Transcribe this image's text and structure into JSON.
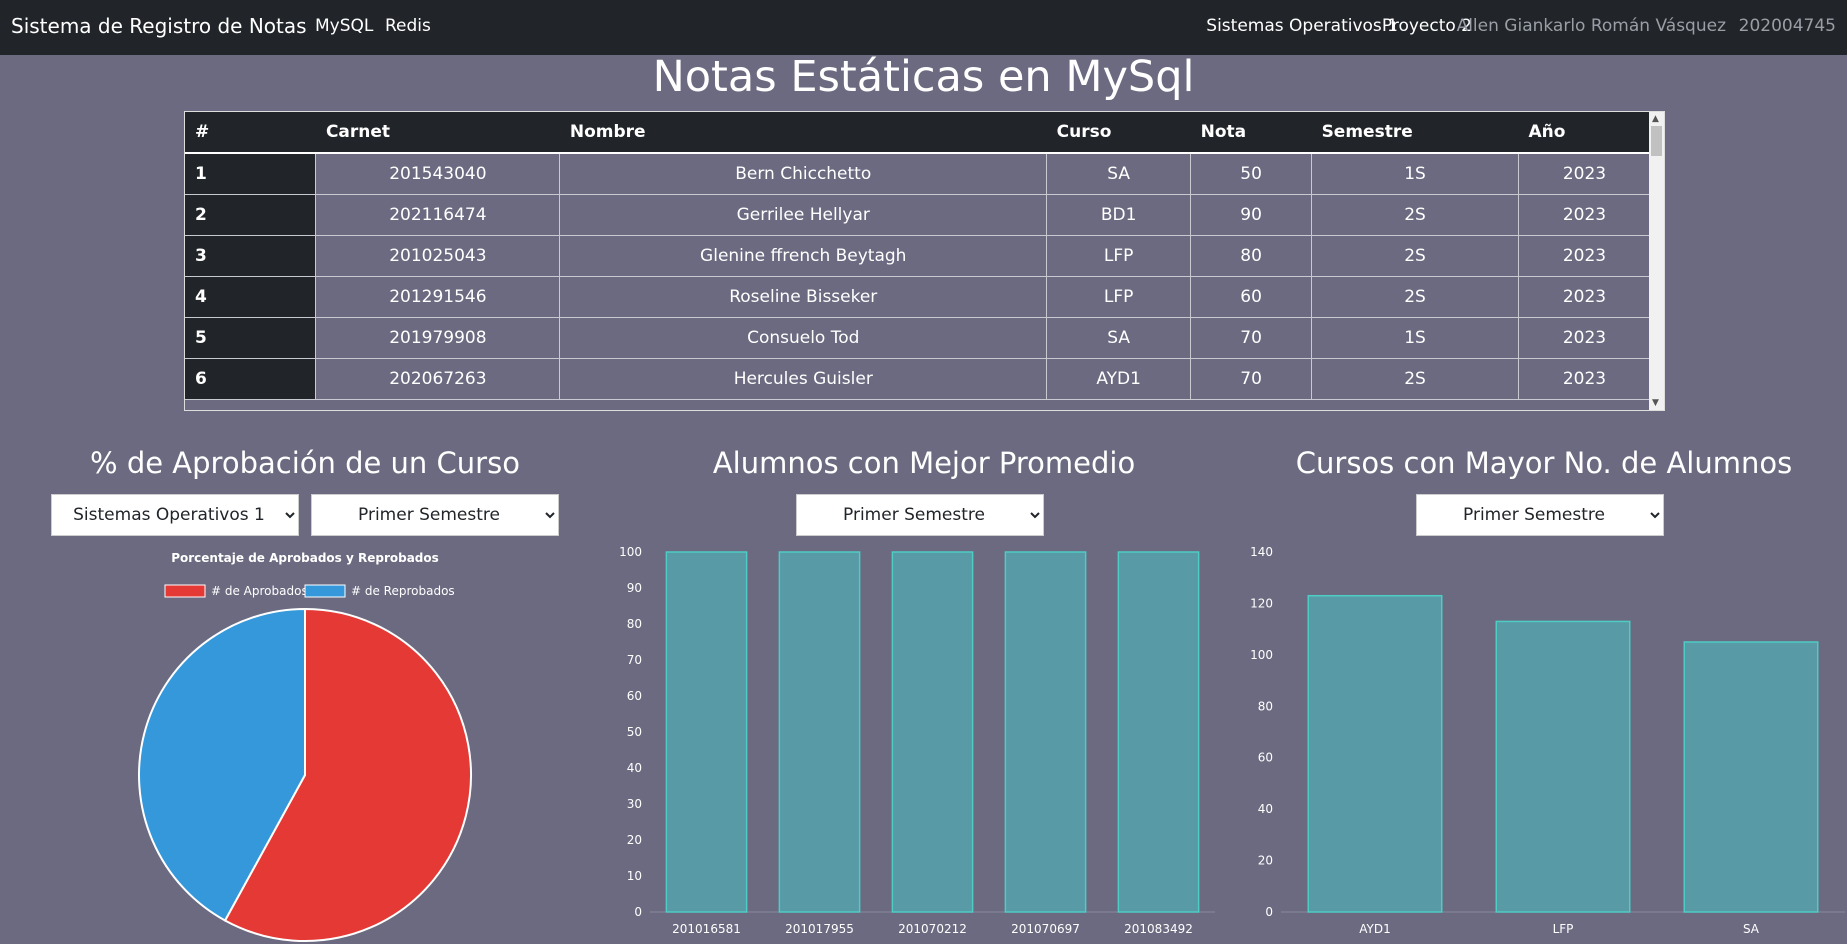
{
  "navbar": {
    "brand": "Sistema de Registro de Notas",
    "links": [
      "MySQL",
      "Redis"
    ],
    "right": [
      "Sistemas Operativos 1",
      "Proyecto 2",
      "Allen Giankarlo Román Vásquez",
      "202004745"
    ]
  },
  "page_title": "Notas Estáticas en MySql",
  "table": {
    "headers": [
      "#",
      "Carnet",
      "Nombre",
      "Curso",
      "Nota",
      "Semestre",
      "Año"
    ],
    "rows": [
      [
        "1",
        "201543040",
        "Bern Chicchetto",
        "SA",
        "50",
        "1S",
        "2023"
      ],
      [
        "2",
        "202116474",
        "Gerrilee Hellyar",
        "BD1",
        "90",
        "2S",
        "2023"
      ],
      [
        "3",
        "201025043",
        "Glenine ffrench Beytagh",
        "LFP",
        "80",
        "2S",
        "2023"
      ],
      [
        "4",
        "201291546",
        "Roseline Bisseker",
        "LFP",
        "60",
        "2S",
        "2023"
      ],
      [
        "5",
        "201979908",
        "Consuelo Tod",
        "SA",
        "70",
        "1S",
        "2023"
      ],
      [
        "6",
        "202067263",
        "Hercules Guisler",
        "AYD1",
        "70",
        "2S",
        "2023"
      ]
    ]
  },
  "sections": {
    "aprobacion": {
      "title": "% de Aprobación de un Curso",
      "course_select": "Sistemas Operativos 1",
      "semester_select": "Primer Semestre"
    },
    "promedio": {
      "title": "Alumnos con Mejor Promedio",
      "semester_select": "Primer Semestre"
    },
    "cursos": {
      "title": "Cursos con Mayor No. de Alumnos",
      "semester_select": "Primer Semestre"
    }
  },
  "chart_data": [
    {
      "type": "pie",
      "title": "Porcentaje de Aprobados y Reprobados",
      "labels": [
        "# de Aprobados",
        "# de Reprobados"
      ],
      "values": [
        58,
        42
      ],
      "colors": [
        "#e53935",
        "#3498db"
      ],
      "legend": "top"
    },
    {
      "type": "bar",
      "categories": [
        "201016581",
        "201017955",
        "201070212",
        "201070697",
        "201083492"
      ],
      "values": [
        100,
        100,
        100,
        100,
        100
      ],
      "ylim": [
        0,
        100
      ],
      "yticks": [
        0,
        10,
        20,
        30,
        40,
        50,
        60,
        70,
        80,
        90,
        100
      ],
      "color": "#56a0a8"
    },
    {
      "type": "bar",
      "categories": [
        "AYD1",
        "LFP",
        "SA"
      ],
      "values": [
        123,
        113,
        105
      ],
      "ylim": [
        0,
        140
      ],
      "yticks": [
        0,
        20,
        40,
        60,
        80,
        100,
        120,
        140
      ],
      "color": "#56a0a8"
    }
  ]
}
